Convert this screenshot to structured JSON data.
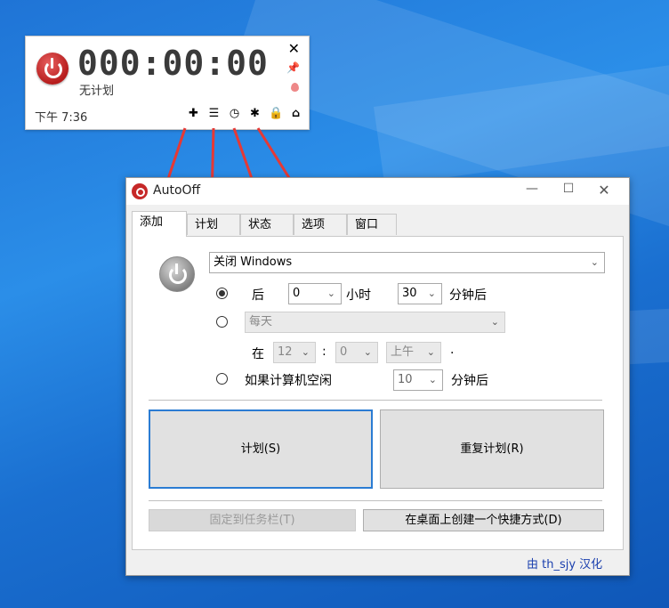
{
  "widget": {
    "timer": "000:00:00",
    "plan_status": "无计划",
    "clock": "下午 7:36",
    "icons": [
      "plus-icon",
      "list-icon",
      "clock-icon",
      "gear-icon",
      "lock-icon",
      "home-icon"
    ],
    "close": "✕",
    "pin": "📌"
  },
  "window": {
    "title": "AutoOff",
    "min": "—",
    "max": "☐",
    "close": "✕",
    "tabs": [
      "添加",
      "计划",
      "状态",
      "选项",
      "窗口"
    ],
    "action_combo": "关闭 Windows",
    "row_after": {
      "label": "后",
      "hours": "0",
      "hours_unit": "小时",
      "minutes": "30",
      "minutes_unit": "分钟后"
    },
    "row_daily": {
      "frequency": "每天",
      "at_label": "在",
      "hour": "12",
      "colon": ":",
      "minute": "0",
      "ampm": "上午",
      "dot": "."
    },
    "row_idle": {
      "label": "如果计算机空闲",
      "minutes": "10",
      "unit": "分钟后"
    },
    "btn_plan": "计划(S)",
    "btn_repeat": "重复计划(R)",
    "btn_pin_taskbar": "固定到任务栏(T)",
    "btn_shortcut": "在桌面上创建一个快捷方式(D)",
    "credit": "由 th_sjy 汉化"
  },
  "colors": {
    "accent_red": "#c62828",
    "arrow_red": "#e53935",
    "focus_blue": "#2b7cd3",
    "desktop_blue": "#2b8ee8"
  }
}
